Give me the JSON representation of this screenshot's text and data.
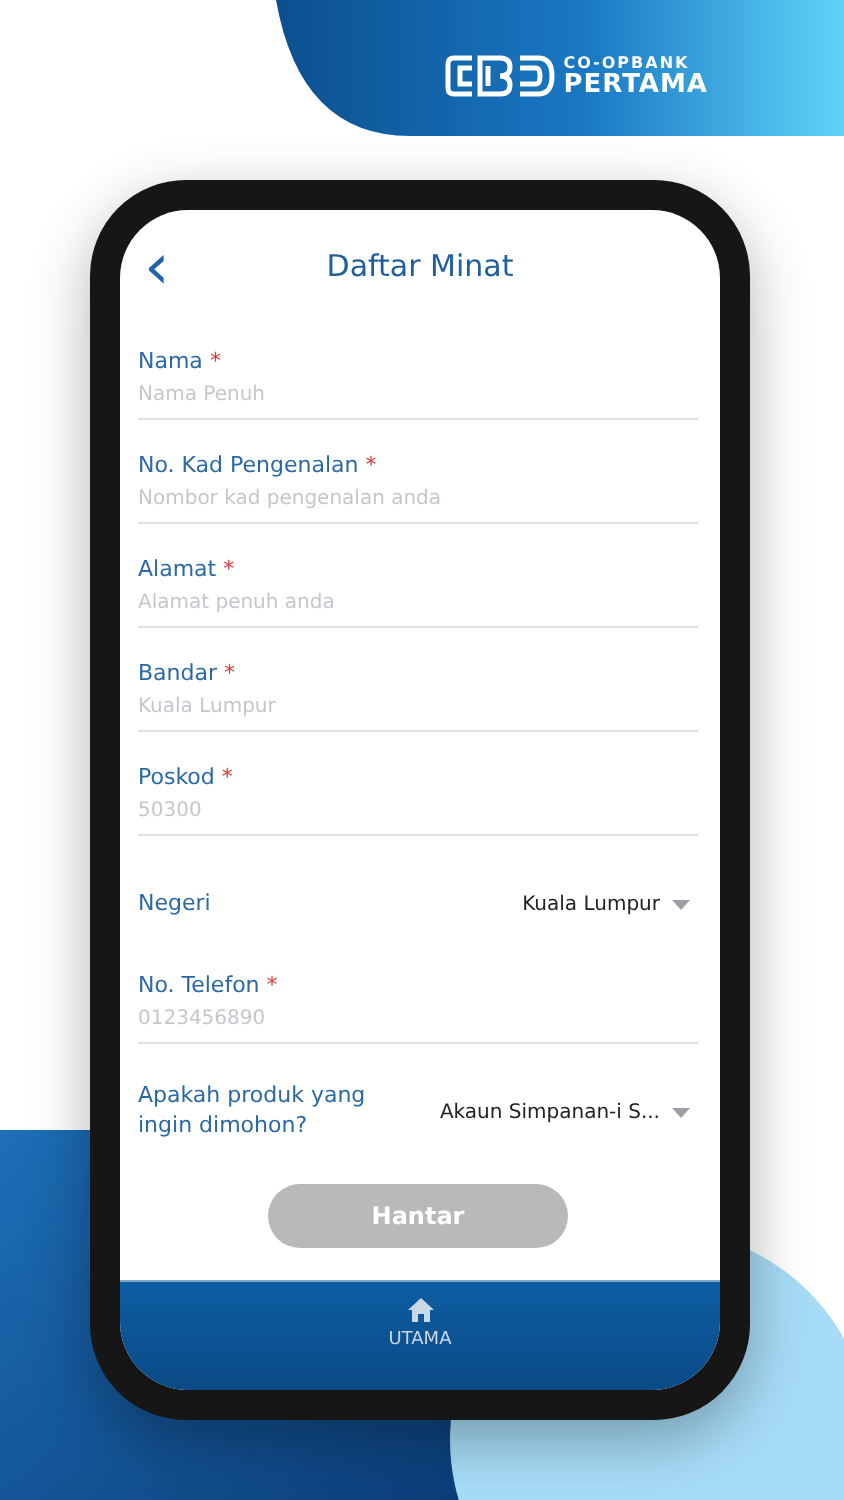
{
  "brand": {
    "line_1": "CO-OPBANK",
    "line_2": "PERTAMA"
  },
  "header": {
    "back": "‹",
    "title": "Daftar Minat"
  },
  "fields": [
    {
      "kind": "text",
      "label": "Nama",
      "mark": "*",
      "placeholder": "Nama Penuh"
    },
    {
      "kind": "text",
      "label": "No. Kad Pengenalan",
      "mark": "*",
      "placeholder": "Nombor kad pengenalan anda"
    },
    {
      "kind": "text",
      "label": "Alamat",
      "mark": "*",
      "placeholder": "Alamat penuh anda"
    },
    {
      "kind": "text",
      "label": "Bandar",
      "mark": "*",
      "placeholder": "Kuala Lumpur"
    },
    {
      "kind": "text",
      "label": "Poskod",
      "mark": "*",
      "placeholder": "50300"
    },
    {
      "kind": "select",
      "label": "Negeri",
      "value": "Kuala Lumpur"
    },
    {
      "kind": "text",
      "label": "No. Telefon",
      "mark": "*",
      "placeholder": "0123456890"
    },
    {
      "kind": "select",
      "label": "Apakah produk yang ingin dimohon?",
      "value": "Akaun Simpanan-i S..."
    }
  ],
  "submit": {
    "label": "Hantar",
    "disabled": true
  },
  "nav": [
    {
      "label": "UTAMA"
    }
  ]
}
